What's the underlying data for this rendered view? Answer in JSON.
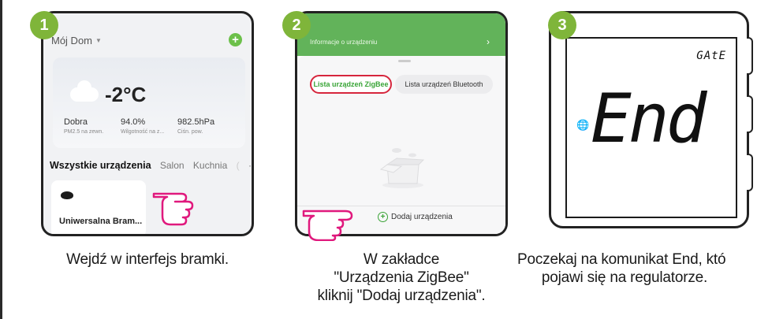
{
  "steps": [
    {
      "number": "1",
      "caption_lines": [
        "Wejdź w interfejs bramki."
      ],
      "app": {
        "home_label": "Mój Dom",
        "weather": {
          "temperature": "-2°C",
          "stats": [
            {
              "value": "Dobra",
              "label": "PM2.5 na zewn."
            },
            {
              "value": "94.0%",
              "label": "Wilgotność na z..."
            },
            {
              "value": "982.5hPa",
              "label": "Ciśn. pow."
            }
          ]
        },
        "tabs": [
          "Wszystkie urządzenia",
          "Salon",
          "Kuchnia",
          "(",
          "···"
        ],
        "device_name": "Uniwersalna Bram..."
      }
    },
    {
      "number": "2",
      "caption_lines": [
        "W zakładce",
        "\"Urządzenia ZigBee\"",
        "kliknij \"Dodaj urządzenia\"."
      ],
      "app": {
        "header_text": "Informacje o urządzeniu",
        "tab_zigbee": "Lista urządzeń ZigBee",
        "tab_bluetooth": "Lista urządzeń Bluetooth",
        "add_devices": "Dodaj urządzenia"
      }
    },
    {
      "number": "3",
      "caption_lines": [
        "Poczekaj na komunikat End, któ",
        "pojawi się na regulatorze."
      ],
      "device": {
        "status_text": "GAtE",
        "main_text": "End"
      }
    }
  ],
  "colors": {
    "step_badge": "#7fb53a",
    "app_green": "#62b35a",
    "highlight_red": "#d6263d",
    "hand_pink": "#e0197d"
  }
}
